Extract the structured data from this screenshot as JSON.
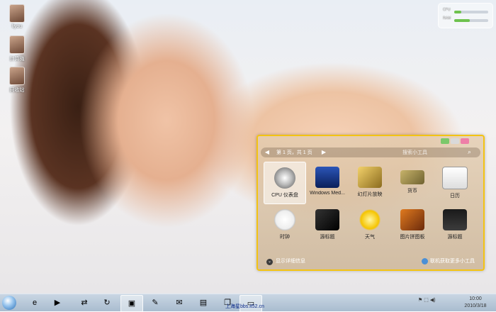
{
  "desktop": {
    "icons": [
      {
        "label": "liyou"
      },
      {
        "label": "計算機"
      },
      {
        "label": "回收站"
      }
    ]
  },
  "gadgets_panel": {
    "page_indicator": "第 1 页，共 1 页",
    "search_placeholder": "搜索小工具",
    "items": [
      {
        "label": "CPU 仪表盘",
        "icon": "cpu-gauge-icon",
        "selected": true
      },
      {
        "label": "Windows Med...",
        "icon": "media-center-icon",
        "selected": false
      },
      {
        "label": "幻灯片放映",
        "icon": "slideshow-icon",
        "selected": false
      },
      {
        "label": "货币",
        "icon": "currency-icon",
        "selected": false
      },
      {
        "label": "日历",
        "icon": "calendar-icon",
        "selected": false
      },
      {
        "label": "时钟",
        "icon": "clock-icon",
        "selected": false
      },
      {
        "label": "源标题",
        "icon": "feed-headlines-icon",
        "selected": false
      },
      {
        "label": "天气",
        "icon": "weather-icon",
        "selected": false
      },
      {
        "label": "图片拼图板",
        "icon": "picture-puzzle-icon",
        "selected": false
      },
      {
        "label": "源标题",
        "icon": "headlines-icon",
        "selected": false
      }
    ],
    "details_label": "显示详细信息",
    "online_label": "联机获取更多小工具"
  },
  "taskbar": {
    "items": [
      "ie-icon",
      "media-player-icon",
      "network-icon",
      "refresh-icon",
      "desktop-icon",
      "paint-icon",
      "photo-icon",
      "gallery-icon",
      "document-icon",
      "window-icon"
    ],
    "center_text": "上海星bbs.it52.cn",
    "tray_icons": [
      "flag-icon",
      "network-tray-icon",
      "volume-icon"
    ],
    "time": "10:00",
    "date": "2010/3/18"
  },
  "colors": {
    "panel_border": "#f3c313",
    "taskbar": "#a9bccf"
  }
}
